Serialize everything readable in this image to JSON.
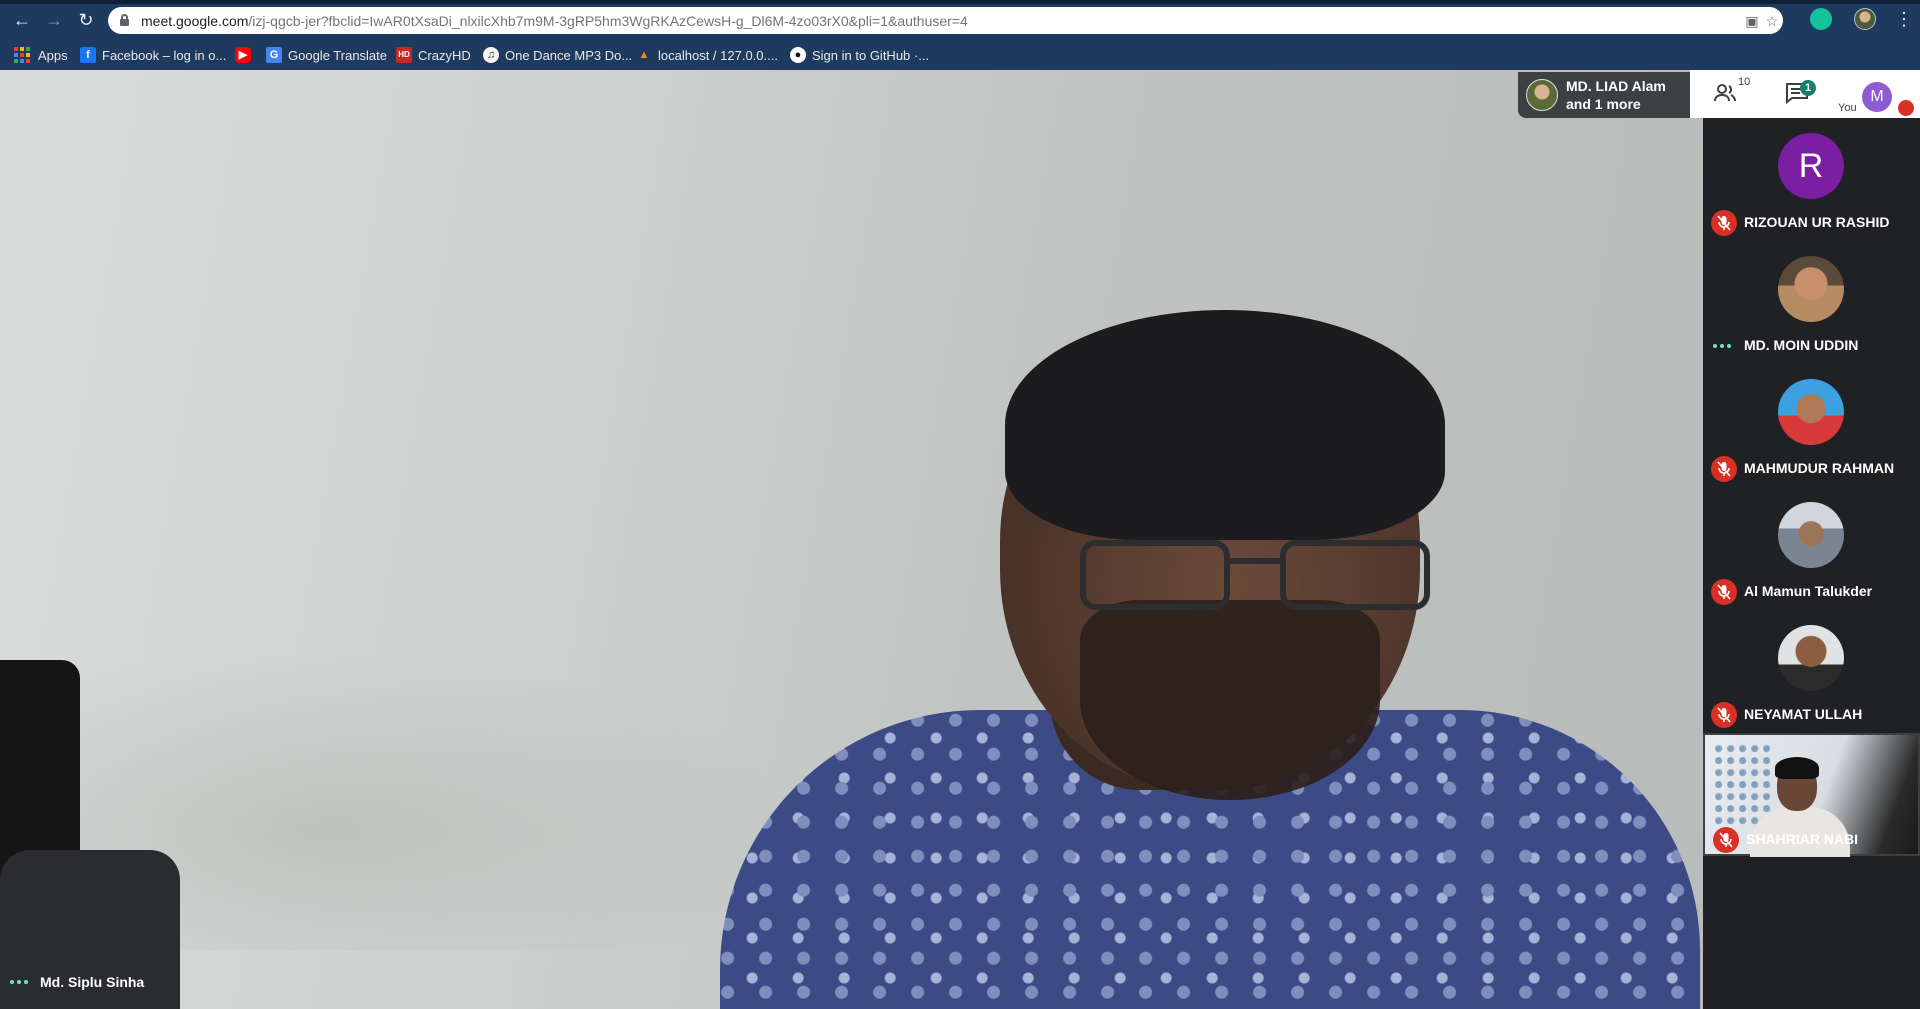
{
  "browser": {
    "url_host": "meet.google.com",
    "url_rest": "/izj-qgcb-jer?fbclid=IwAR0tXsaDi_nlxilcXhb7m9M-3gRP5hm3WgRKAzCewsH-g_Dl6M-4zo03rX0&pli=1&authuser=4",
    "bookmarks": [
      {
        "label": "Apps",
        "icon": "apps-grid-icon"
      },
      {
        "label": "Facebook – log in o...",
        "icon": "facebook-icon",
        "color": "#1877f2"
      },
      {
        "label": "",
        "icon": "youtube-icon",
        "color": "#ff0000"
      },
      {
        "label": "Google Translate",
        "icon": "google-translate-icon",
        "color": "#4285f4"
      },
      {
        "label": "CrazyHD",
        "icon": "crazyhd-icon",
        "color": "#c62828"
      },
      {
        "label": "One Dance MP3 Do...",
        "icon": "music-icon",
        "color": "#f5f5f5"
      },
      {
        "label": "localhost / 127.0.0....",
        "icon": "phpmyadmin-icon",
        "color": "#f29111"
      },
      {
        "label": "Sign in to GitHub ·...",
        "icon": "github-icon",
        "color": "#ffffff"
      }
    ]
  },
  "meeting": {
    "presenter_line1": "MD. LIAD Alam",
    "presenter_line2": "and 1 more",
    "people_count": "10",
    "chat_unread": "1",
    "you_initial": "M",
    "you_label": "You",
    "main_speaker": "Md. Siplu Sinha"
  },
  "participants": [
    {
      "name": "RIZOUAN UR RASHID",
      "avatar": "R",
      "state": "muted"
    },
    {
      "name": "MD. MOIN UDDIN",
      "state": "talking"
    },
    {
      "name": "MAHMUDUR RAHMAN",
      "state": "muted"
    },
    {
      "name": "Al Mamun Talukder",
      "state": "muted"
    },
    {
      "name": "NEYAMAT ULLAH",
      "state": "muted"
    },
    {
      "name": "SHAHRIAR NABI",
      "state": "muted",
      "video": true
    }
  ],
  "colors": {
    "chrome_bg": "#1f3a5f",
    "accent_talk": "#6ee2c7",
    "mute_red": "#d93025",
    "avatar_purple": "#7b1fa2",
    "you_purple": "#8e5bd1",
    "chat_badge": "#1a7f64"
  }
}
